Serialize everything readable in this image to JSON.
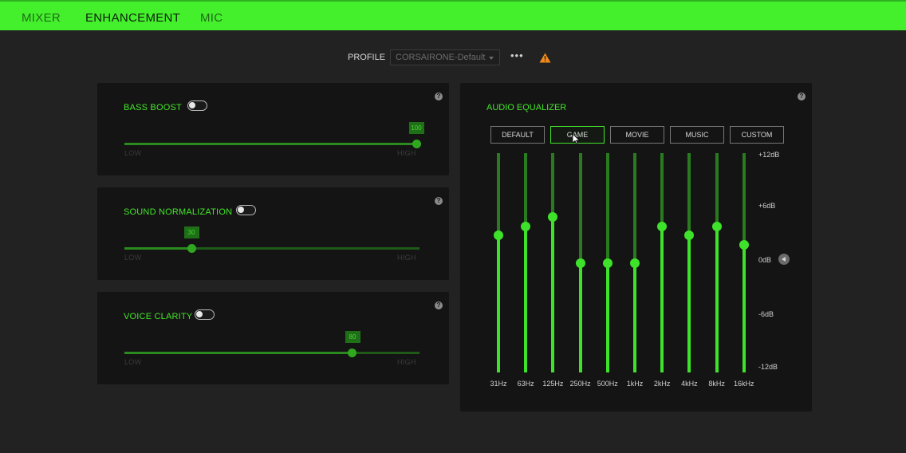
{
  "tabs": {
    "mixer": "MIXER",
    "enhancement": "ENHANCEMENT",
    "mic": "MIC",
    "active": "ENHANCEMENT"
  },
  "profile": {
    "label": "PROFILE",
    "selected": "CORSAIRONE-Default",
    "more": "•••"
  },
  "bass_boost": {
    "title": "BASS BOOST",
    "enabled": false,
    "value": "100",
    "low": "LOW",
    "high": "HIGH",
    "level": 1.0
  },
  "sound_normalization": {
    "title": "SOUND NORMALIZATION",
    "enabled": false,
    "value": "30",
    "low": "LOW",
    "high": "HIGH",
    "level": 0.23
  },
  "voice_clarity": {
    "title": "VOICE CLARITY",
    "enabled": false,
    "value": "80",
    "low": "LOW",
    "high": "HIGH",
    "level": 0.77
  },
  "help": "?",
  "equalizer": {
    "title": "AUDIO EQUALIZER",
    "presets": [
      "DEFAULT",
      "GAME",
      "MOVIE",
      "MUSIC",
      "CUSTOM"
    ],
    "active_preset": "GAME",
    "bands": [
      {
        "freq": "31Hz",
        "db": 3
      },
      {
        "freq": "63Hz",
        "db": 4
      },
      {
        "freq": "125Hz",
        "db": 5
      },
      {
        "freq": "250Hz",
        "db": 0
      },
      {
        "freq": "500Hz",
        "db": 0
      },
      {
        "freq": "1kHz",
        "db": 0
      },
      {
        "freq": "2kHz",
        "db": 4
      },
      {
        "freq": "4kHz",
        "db": 3
      },
      {
        "freq": "8kHz",
        "db": 4
      },
      {
        "freq": "16kHz",
        "db": 2
      }
    ],
    "db_labels": [
      "+12dB",
      "+6dB",
      "0dB",
      "-6dB",
      "-12dB"
    ],
    "range": [
      -12,
      12
    ]
  },
  "colors": {
    "accent": "#44f02c",
    "panel": "#141414",
    "background": "#222222",
    "warning": "#f08a1c"
  }
}
